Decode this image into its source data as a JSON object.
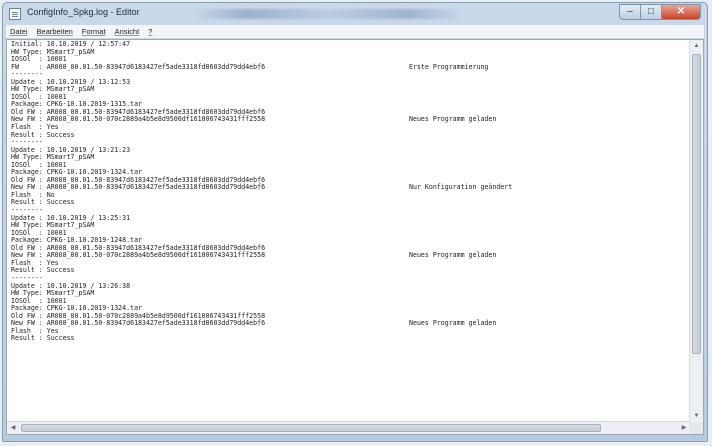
{
  "window": {
    "title": "ConfigInfo_Spkg.log - Editor",
    "controls": {
      "minimize": "–",
      "maximize": "□",
      "close": "✕"
    }
  },
  "menu": [
    {
      "label": "Datei"
    },
    {
      "label": "Bearbeiten"
    },
    {
      "label": "Format"
    },
    {
      "label": "Ansicht"
    },
    {
      "label": "?"
    }
  ],
  "lines": [
    [
      "Initial: 10.10.2019 / 12:57:47",
      ""
    ],
    [
      "HW Type: MSmart7_pSAM",
      ""
    ],
    [
      "IOSOl  : 10001",
      ""
    ],
    [
      "FW     : AR008_00.01.50-83947d6183427ef5ade3318fd8603dd79dd4ebf6",
      "Erste Programmierung"
    ],
    [
      "--------",
      ""
    ],
    [
      "Update : 10.10.2019 / 13:12:53",
      ""
    ],
    [
      "HW Type: MSmart7_pSAM",
      ""
    ],
    [
      "IOSOl  : 10001",
      ""
    ],
    [
      "Package: CPKG-10.10.2019-1315.tar",
      ""
    ],
    [
      "Old FW : AR008_00.01.50-83947d6183427ef5ade3318fd8603dd79dd4ebf6",
      ""
    ],
    [
      "New FW : AR008_00.01.50-070c2889a4b5e8d9500df161006743431fff2558",
      "Neues Programm geladen"
    ],
    [
      "Flash  : Yes",
      ""
    ],
    [
      "Result : Success",
      ""
    ],
    [
      "--------",
      ""
    ],
    [
      "Update : 10.10.2019 / 13:21:23",
      ""
    ],
    [
      "HW Type: MSmart7_pSAM",
      ""
    ],
    [
      "IOSOl  : 10001",
      ""
    ],
    [
      "Package: CPKG-10.10.2019-1324.tar",
      ""
    ],
    [
      "Old FW : AR008_00.01.50-83947d6183427ef5ade3318fd8603dd79dd4ebf6",
      ""
    ],
    [
      "New FW : AR008_00.01.50-83947d6183427ef5ade3318fd8603dd79dd4ebf6",
      "Nur Konfiguration geändert"
    ],
    [
      "Flash  : No",
      ""
    ],
    [
      "Result : Success",
      ""
    ],
    [
      "--------",
      ""
    ],
    [
      "Update : 10.10.2019 / 13:25:31",
      ""
    ],
    [
      "HW Type: MSmart7_pSAM",
      ""
    ],
    [
      "IOSOl  : 10001",
      ""
    ],
    [
      "Package: CPKG-10.10.2019-1248.tar",
      ""
    ],
    [
      "Old FW : AR008_00.01.50-83947d6183427ef5ade3318fd8603dd79dd4ebf6",
      ""
    ],
    [
      "New FW : AR008_00.01.50-070c2889a4b5e8d9500df161006743431fff2558",
      "Neues Programm geladen"
    ],
    [
      "Flash  : Yes",
      ""
    ],
    [
      "Result : Success",
      ""
    ],
    [
      "--------",
      ""
    ],
    [
      "Update : 10.10.2019 / 13:26:38",
      ""
    ],
    [
      "HW Type: MSmart7_pSAM",
      ""
    ],
    [
      "IOSOl  : 10001",
      ""
    ],
    [
      "Package: CPKG-10.10.2019-1324.tar",
      ""
    ],
    [
      "Old FW : AR008_00.01.50-070c2889a4b5e8d9500df161006743431fff2558",
      ""
    ],
    [
      "New FW : AR008_00.01.50-83947d6183427ef5ade3318fd8603dd79dd4ebf6",
      "Neues Programm geladen"
    ],
    [
      "Flash  : Yes",
      ""
    ],
    [
      "Result : Success",
      ""
    ]
  ],
  "scrollbars": {
    "up": "▲",
    "down": "▼",
    "left": "◀",
    "right": "▶"
  }
}
